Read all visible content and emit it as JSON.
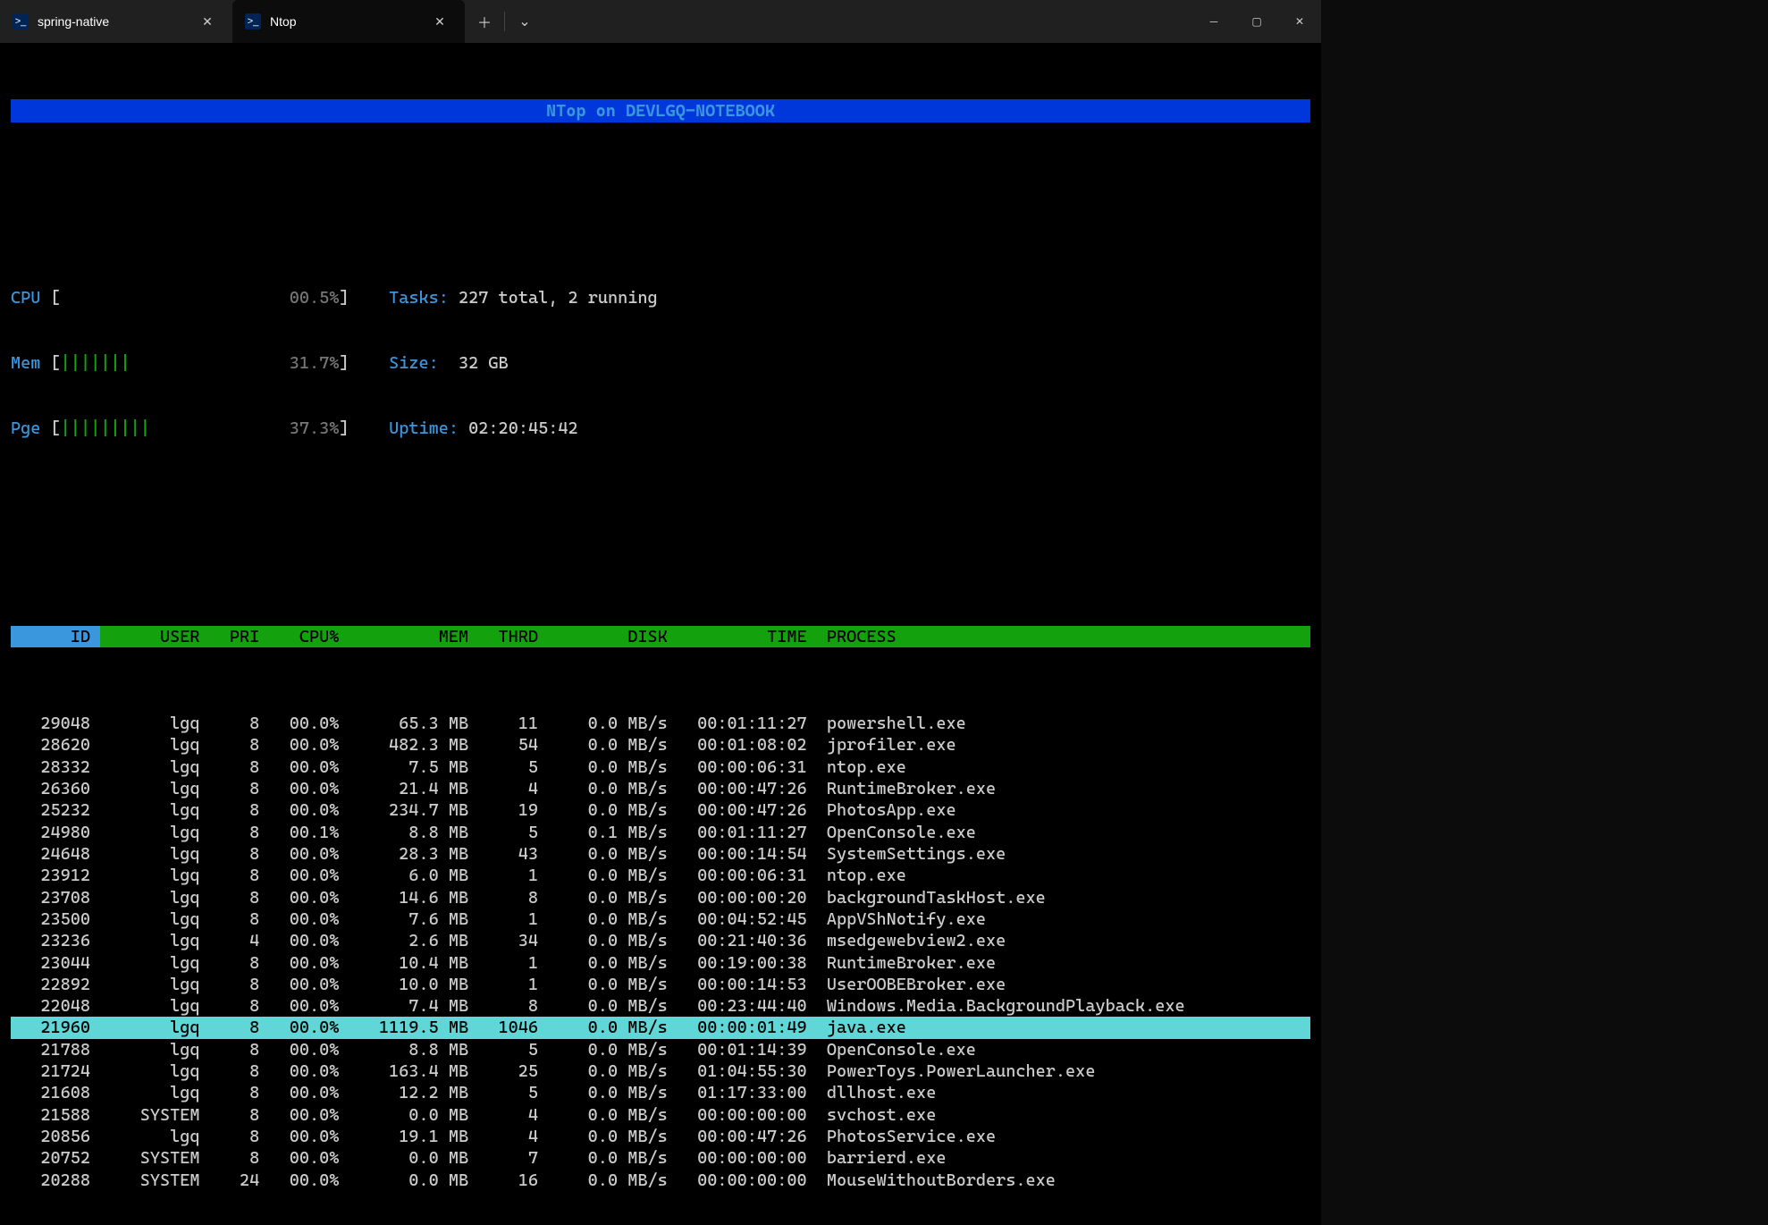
{
  "tabs": [
    {
      "title": "spring-native",
      "active": false
    },
    {
      "title": "Ntop",
      "active": true
    }
  ],
  "banner": "NTop on DEVLGQ-NOTEBOOK",
  "meters": {
    "cpu": {
      "label": "CPU",
      "bars": "",
      "pct": "00.5%"
    },
    "mem": {
      "label": "Mem",
      "bars": "|||||||",
      "pct": "31.7%"
    },
    "pge": {
      "label": "Pge",
      "bars": "|||||||||",
      "pct": "37.3%"
    }
  },
  "info": {
    "tasks_label": "Tasks:",
    "tasks_value": "227 total, 2 running",
    "size_label": "Size:",
    "size_value": "32 GB",
    "uptime_label": "Uptime:",
    "uptime_value": "02:20:45:42"
  },
  "columns": {
    "id": "ID",
    "user": "USER",
    "pri": "PRI",
    "cpu": "CPU%",
    "mem": "MEM",
    "thrd": "THRD",
    "disk": "DISK",
    "time": "TIME",
    "proc": "PROCESS"
  },
  "selected_id": 21960,
  "processes": [
    {
      "id": 29048,
      "user": "lgq",
      "pri": 8,
      "cpu": "00.0%",
      "mem": "65.3 MB",
      "thrd": 11,
      "disk": "0.0 MB/s",
      "time": "00:01:11:27",
      "proc": "powershell.exe"
    },
    {
      "id": 28620,
      "user": "lgq",
      "pri": 8,
      "cpu": "00.0%",
      "mem": "482.3 MB",
      "thrd": 54,
      "disk": "0.0 MB/s",
      "time": "00:01:08:02",
      "proc": "jprofiler.exe"
    },
    {
      "id": 28332,
      "user": "lgq",
      "pri": 8,
      "cpu": "00.0%",
      "mem": "7.5 MB",
      "thrd": 5,
      "disk": "0.0 MB/s",
      "time": "00:00:06:31",
      "proc": "ntop.exe"
    },
    {
      "id": 26360,
      "user": "lgq",
      "pri": 8,
      "cpu": "00.0%",
      "mem": "21.4 MB",
      "thrd": 4,
      "disk": "0.0 MB/s",
      "time": "00:00:47:26",
      "proc": "RuntimeBroker.exe"
    },
    {
      "id": 25232,
      "user": "lgq",
      "pri": 8,
      "cpu": "00.0%",
      "mem": "234.7 MB",
      "thrd": 19,
      "disk": "0.0 MB/s",
      "time": "00:00:47:26",
      "proc": "PhotosApp.exe"
    },
    {
      "id": 24980,
      "user": "lgq",
      "pri": 8,
      "cpu": "00.1%",
      "mem": "8.8 MB",
      "thrd": 5,
      "disk": "0.1 MB/s",
      "time": "00:01:11:27",
      "proc": "OpenConsole.exe"
    },
    {
      "id": 24648,
      "user": "lgq",
      "pri": 8,
      "cpu": "00.0%",
      "mem": "28.3 MB",
      "thrd": 43,
      "disk": "0.0 MB/s",
      "time": "00:00:14:54",
      "proc": "SystemSettings.exe"
    },
    {
      "id": 23912,
      "user": "lgq",
      "pri": 8,
      "cpu": "00.0%",
      "mem": "6.0 MB",
      "thrd": 1,
      "disk": "0.0 MB/s",
      "time": "00:00:06:31",
      "proc": "ntop.exe"
    },
    {
      "id": 23708,
      "user": "lgq",
      "pri": 8,
      "cpu": "00.0%",
      "mem": "14.6 MB",
      "thrd": 8,
      "disk": "0.0 MB/s",
      "time": "00:00:00:20",
      "proc": "backgroundTaskHost.exe"
    },
    {
      "id": 23500,
      "user": "lgq",
      "pri": 8,
      "cpu": "00.0%",
      "mem": "7.6 MB",
      "thrd": 1,
      "disk": "0.0 MB/s",
      "time": "00:04:52:45",
      "proc": "AppVShNotify.exe"
    },
    {
      "id": 23236,
      "user": "lgq",
      "pri": 4,
      "cpu": "00.0%",
      "mem": "2.6 MB",
      "thrd": 34,
      "disk": "0.0 MB/s",
      "time": "00:21:40:36",
      "proc": "msedgewebview2.exe"
    },
    {
      "id": 23044,
      "user": "lgq",
      "pri": 8,
      "cpu": "00.0%",
      "mem": "10.4 MB",
      "thrd": 1,
      "disk": "0.0 MB/s",
      "time": "00:19:00:38",
      "proc": "RuntimeBroker.exe"
    },
    {
      "id": 22892,
      "user": "lgq",
      "pri": 8,
      "cpu": "00.0%",
      "mem": "10.0 MB",
      "thrd": 1,
      "disk": "0.0 MB/s",
      "time": "00:00:14:53",
      "proc": "UserOOBEBroker.exe"
    },
    {
      "id": 22048,
      "user": "lgq",
      "pri": 8,
      "cpu": "00.0%",
      "mem": "7.4 MB",
      "thrd": 8,
      "disk": "0.0 MB/s",
      "time": "00:23:44:40",
      "proc": "Windows.Media.BackgroundPlayback.exe"
    },
    {
      "id": 21960,
      "user": "lgq",
      "pri": 8,
      "cpu": "00.0%",
      "mem": "1119.5 MB",
      "thrd": 1046,
      "disk": "0.0 MB/s",
      "time": "00:00:01:49",
      "proc": "java.exe"
    },
    {
      "id": 21788,
      "user": "lgq",
      "pri": 8,
      "cpu": "00.0%",
      "mem": "8.8 MB",
      "thrd": 5,
      "disk": "0.0 MB/s",
      "time": "00:01:14:39",
      "proc": "OpenConsole.exe"
    },
    {
      "id": 21724,
      "user": "lgq",
      "pri": 8,
      "cpu": "00.0%",
      "mem": "163.4 MB",
      "thrd": 25,
      "disk": "0.0 MB/s",
      "time": "01:04:55:30",
      "proc": "PowerToys.PowerLauncher.exe"
    },
    {
      "id": 21608,
      "user": "lgq",
      "pri": 8,
      "cpu": "00.0%",
      "mem": "12.2 MB",
      "thrd": 5,
      "disk": "0.0 MB/s",
      "time": "01:17:33:00",
      "proc": "dllhost.exe"
    },
    {
      "id": 21588,
      "user": "SYSTEM",
      "pri": 8,
      "cpu": "00.0%",
      "mem": "0.0 MB",
      "thrd": 4,
      "disk": "0.0 MB/s",
      "time": "00:00:00:00",
      "proc": "svchost.exe"
    },
    {
      "id": 20856,
      "user": "lgq",
      "pri": 8,
      "cpu": "00.0%",
      "mem": "19.1 MB",
      "thrd": 4,
      "disk": "0.0 MB/s",
      "time": "00:00:47:26",
      "proc": "PhotosService.exe"
    },
    {
      "id": 20752,
      "user": "SYSTEM",
      "pri": 8,
      "cpu": "00.0%",
      "mem": "0.0 MB",
      "thrd": 7,
      "disk": "0.0 MB/s",
      "time": "00:00:00:00",
      "proc": "barrierd.exe"
    },
    {
      "id": 20288,
      "user": "SYSTEM",
      "pri": 24,
      "cpu": "00.0%",
      "mem": "0.0 MB",
      "thrd": 16,
      "disk": "0.0 MB/s",
      "time": "00:00:00:00",
      "proc": "MouseWithoutBorders.exe"
    }
  ]
}
